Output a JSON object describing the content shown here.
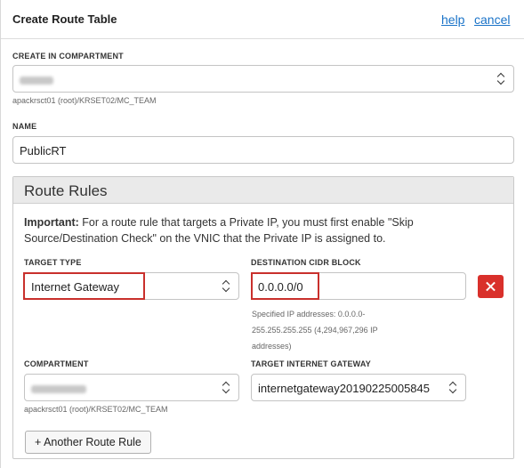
{
  "header": {
    "title": "Create Route Table",
    "help_label": "help",
    "cancel_label": "cancel"
  },
  "compartment": {
    "label": "CREATE IN COMPARTMENT",
    "value": "MC_TEAM",
    "path_hint": "apackrsct01 (root)/KRSET02/MC_TEAM"
  },
  "name": {
    "label": "NAME",
    "value": "PublicRT"
  },
  "route_rules": {
    "title": "Route Rules",
    "important_label": "Important:",
    "important_text": " For a route rule that targets a Private IP, you must first enable \"Skip Source/Destination Check\" on the VNIC that the Private IP is assigned to.",
    "rule": {
      "target_type_label": "TARGET TYPE",
      "target_type_value": "Internet Gateway",
      "destination_label": "DESTINATION CIDR BLOCK",
      "destination_value": "0.0.0.0/0",
      "destination_hint_1": "Specified IP addresses: 0.0.0.0-",
      "destination_hint_2": "255.255.255.255 (4,294,967,296 IP",
      "destination_hint_3": "addresses)",
      "compartment_label": "COMPARTMENT",
      "compartment_value": "MC_TEAM",
      "compartment_hint": "apackrsct01 (root)/KRSET02/MC_TEAM",
      "target_gateway_label": "TARGET INTERNET GATEWAY",
      "target_gateway_value": "internetgateway20190225005845"
    },
    "add_rule_label": "+ Another Route Rule"
  },
  "colors": {
    "link": "#1a73c8",
    "highlight": "#c9302c",
    "delete_button": "#d9302b"
  },
  "icons": {
    "select_chevron": "chevron-up-down-icon",
    "delete": "close-icon"
  }
}
